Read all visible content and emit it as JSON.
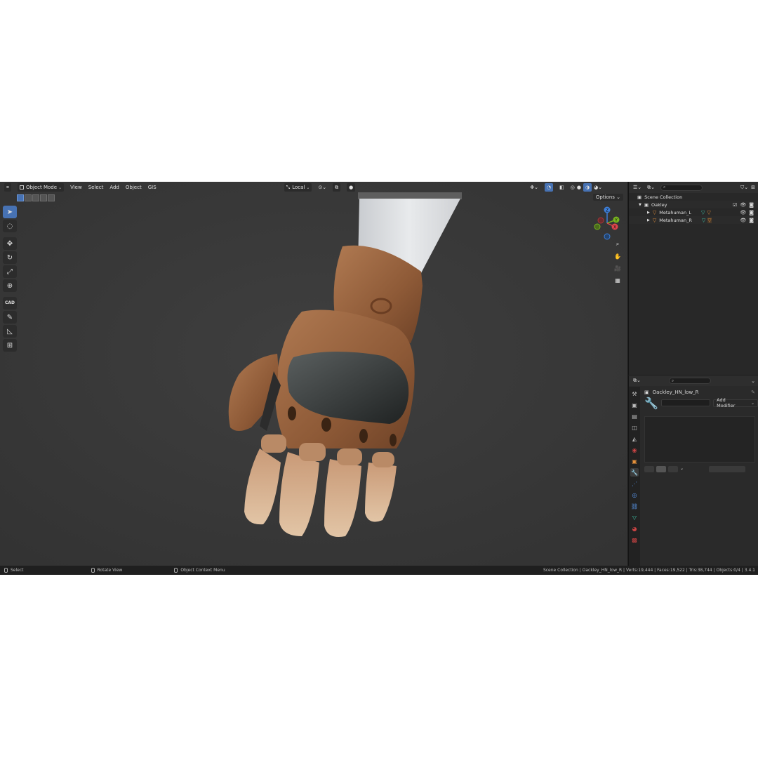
{
  "header": {
    "editor_type": "⌗",
    "mode": "Object Mode",
    "menus": [
      "View",
      "Select",
      "Add",
      "Object",
      "GIS"
    ],
    "transform_orientation": "Local",
    "options": "Options"
  },
  "toolbar": {
    "cad_label": "CAD"
  },
  "gizmo": {
    "z_label": "Z",
    "y_label": "Y",
    "x_label": "X"
  },
  "outliner": {
    "search_placeholder": "",
    "rows": [
      {
        "label": "Scene Collection"
      },
      {
        "label": "Oakley"
      },
      {
        "label": "Metahuman_L"
      },
      {
        "label": "Metahuman_R"
      }
    ]
  },
  "properties": {
    "search_placeholder": "",
    "object_name": "Oackley_HN_low_R",
    "add_modifier": "Add Modifier"
  },
  "status": {
    "select": "Select",
    "rotate": "Rotate View",
    "context_menu": "Object Context Menu",
    "stats": "Scene Collection | Oackley_HN_low_R | Verts:19,444 | Faces:19,522 | Tris:38,744 | Objects:0/4 | 3.4.1"
  },
  "colors": {
    "accent": "#4772b3",
    "viewport_bg": "#3a3a3a",
    "leather": "#9b6440",
    "axis_x": "#e0454b",
    "axis_y": "#77b31e",
    "axis_z": "#3d7fd9"
  }
}
